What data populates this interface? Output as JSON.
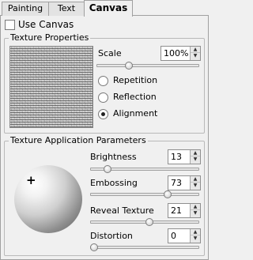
{
  "tabs": [
    {
      "label": "Painting",
      "active": false
    },
    {
      "label": "Text",
      "active": false
    },
    {
      "label": "Canvas",
      "active": true
    }
  ],
  "use_canvas": {
    "label": "Use Canvas",
    "checked": false
  },
  "texture_properties": {
    "title": "Texture Properties",
    "scale": {
      "label": "Scale",
      "value": "100%",
      "slider_level": 0.3
    },
    "mode_options": [
      {
        "label": "Repetition",
        "selected": false
      },
      {
        "label": "Reflection",
        "selected": false
      },
      {
        "label": "Alignment",
        "selected": true
      }
    ]
  },
  "application": {
    "title": "Texture Application Parameters",
    "params": [
      {
        "label": "Brightness",
        "value": "13",
        "slider_level": 0.13
      },
      {
        "label": "Embossing",
        "value": "73",
        "slider_level": 0.73
      },
      {
        "label": "Reveal Texture",
        "value": "21",
        "slider_level": 0.55
      },
      {
        "label": "Distortion",
        "value": "0",
        "slider_level": 0
      }
    ],
    "light_marker": "+"
  },
  "icons": {
    "spin_up": "up-arrow-icon",
    "spin_down": "down-arrow-icon",
    "light_marker": "crosshair-icon"
  }
}
